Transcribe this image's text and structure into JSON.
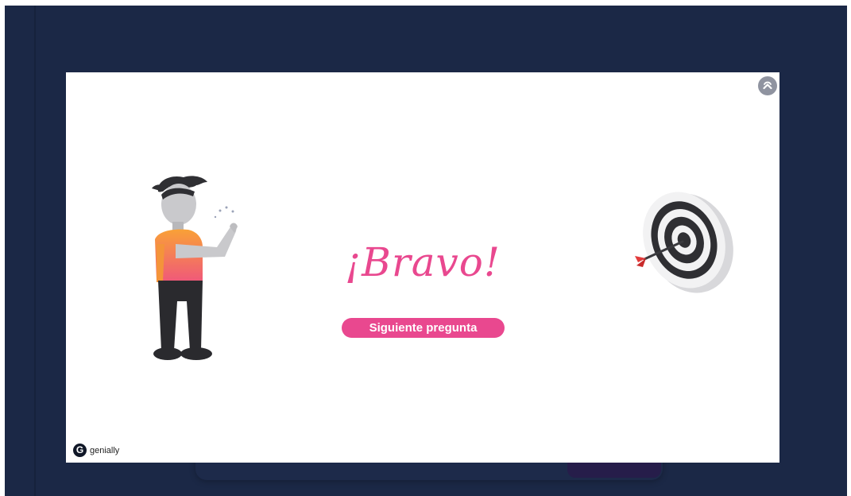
{
  "modal": {
    "headline": "¡Bravo!",
    "next_button_label": "Siguiente pregunta",
    "brand_name": "genially",
    "brand_icon_letter": "G",
    "close_icon": "close-icon",
    "illustrations": [
      "character-throwing",
      "dartboard-target"
    ]
  },
  "colors": {
    "backdrop": "#1b2846",
    "accent_pink": "#e9488f",
    "modal_bg": "#ffffff"
  }
}
